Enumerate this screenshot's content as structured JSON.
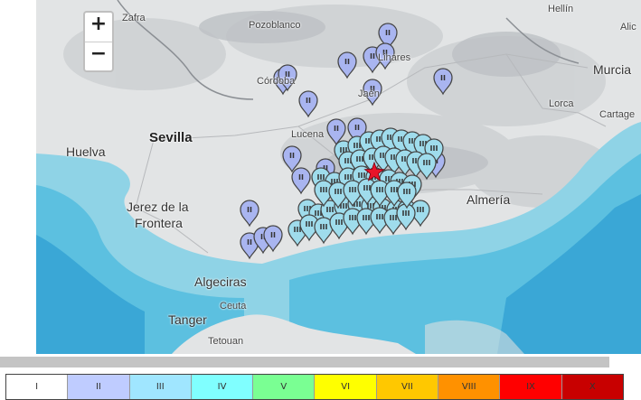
{
  "zoom": {
    "in_label": "+",
    "out_label": "−"
  },
  "cities": {
    "zafra": "Zafra",
    "pozoblanco": "Pozoblanco",
    "hellin": "Hellín",
    "alicante": "Alic",
    "cordoba": "Córdoba",
    "jaen": "Jaén",
    "linares": "Linares",
    "murcia": "Murcia",
    "lorca": "Lorca",
    "cartagena": "Cartage",
    "sevilla": "Sevilla",
    "huelva": "Huelva",
    "lucena": "Lucena",
    "jerez": "Jerez de la",
    "frontera": "Frontera",
    "almeria": "Almería",
    "algeciras": "Algeciras",
    "ceuta": "Ceuta",
    "tanger": "Tanger",
    "tetouan": "Tetouan"
  },
  "epicenter_icon": "red-star-icon",
  "intensity_legend": [
    {
      "label": "I",
      "color": "#ffffff"
    },
    {
      "label": "II",
      "color": "#bfccff"
    },
    {
      "label": "III",
      "color": "#a0e6ff"
    },
    {
      "label": "IV",
      "color": "#80ffff"
    },
    {
      "label": "V",
      "color": "#7aff93"
    },
    {
      "label": "VI",
      "color": "#ffff00"
    },
    {
      "label": "VII",
      "color": "#ffc800"
    },
    {
      "label": "VIII",
      "color": "#ff9100"
    },
    {
      "label": "IX",
      "color": "#ff0000"
    },
    {
      "label": "X",
      "color": "#c80000"
    }
  ],
  "pin_colors": {
    "II": "#a9b5f0",
    "III": "#9fdcec"
  }
}
